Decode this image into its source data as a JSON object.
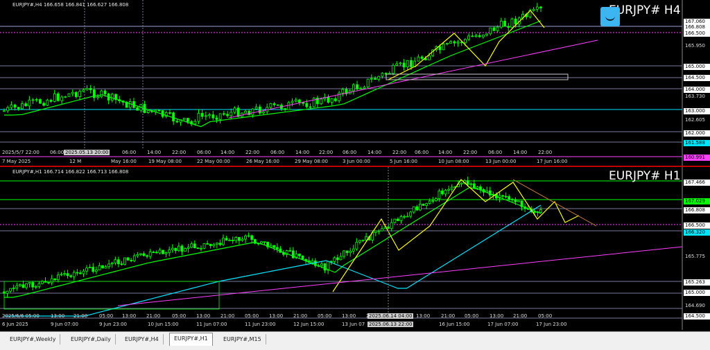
{
  "top_chart": {
    "header": "EURJPY#,H4  166.658 166.841 166.627 166.808",
    "big_title": "EURJPY# H4",
    "price_labels": [
      "167.060",
      "166.808",
      "166.500",
      "165.950",
      "165.000",
      "164.500",
      "164.000",
      "163.730",
      "163.000",
      "162.605",
      "162.000",
      "161.588",
      "160.991"
    ],
    "time_labels": [
      "7 May 2025",
      "12 M",
      "May 16:00",
      "19 May 08:00",
      "22 May 00:00",
      "26 May 16:00",
      "29 May 08:00",
      "3 Jun 00:00",
      "5 Jun 16:00",
      "10 Jun 08:00",
      "13 Jun 00:00",
      "17 Jun 16:00"
    ],
    "grid_labels": [
      "2025/5/7 22:00",
      "06:00",
      "2025.05.14 02:00",
      "06:00",
      "14:00",
      "22:00",
      "06:00",
      "14:00",
      "22:00",
      "06:00",
      "14:00",
      "22:00",
      "06:00",
      "14:00",
      "22:00",
      "06:00",
      "14:00",
      "22:00",
      "06:00",
      "14:00",
      "22:00"
    ],
    "bubble": "2025.05.13 20:00",
    "colors": {
      "highlight": "#00e5ff",
      "magenta": "#ff40ff"
    }
  },
  "bottom_chart": {
    "header": "EURJPY#,H1  166.714 166.822 166.713 166.808",
    "big_title": "EURJPY# H1",
    "price_labels": [
      "167.466",
      "167.029",
      "166.808",
      "166.500",
      "166.320",
      "165.775",
      "165.263",
      "165.000",
      "164.690",
      "164.500"
    ],
    "time_labels": [
      "6 Jun 2025",
      "9 Jun 07:00",
      "9 Jun 23:00",
      "10 Jun 15:00",
      "11 Jun 07:00",
      "11 Jun 23:00",
      "12 Jun 15:00",
      "13 Jun 07",
      "16 Jun 15:00",
      "17 Jun 07:00",
      "17 Jun 23:00"
    ],
    "grid_labels": [
      "2025/6/6 05:00",
      "13:00",
      "21:00",
      "05:00",
      "13:00",
      "21:00",
      "05:00",
      "13:00",
      "21:00",
      "05:00",
      "13:00",
      "21:00",
      "05:00",
      "13:00",
      "21:00",
      "05:00",
      "13:00",
      "21:00",
      "05:00",
      "13:00",
      "21:00",
      "05:00"
    ],
    "bubbles": [
      "2025.06.14 04:00",
      "2025.06.13 22:00"
    ],
    "colors": {
      "green": "#00ff00",
      "cyan": "#00e5ff"
    }
  },
  "tabs": [
    "EURJPY#,Weekly",
    "EURJPY#,Daily",
    "EURJPY#,H4",
    "EURJPY#,H1",
    "EURJPY#,M15"
  ],
  "active_tab": "EURJPY#,H1"
}
